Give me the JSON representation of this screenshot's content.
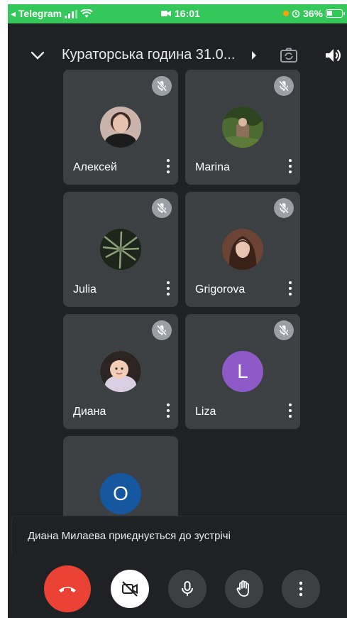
{
  "status_bar": {
    "back_app": "◂ Telegram",
    "time": "16:01",
    "battery": "36%",
    "battery_level": 0.36
  },
  "header": {
    "title": "Кураторська година 31.0..."
  },
  "participants": [
    {
      "name": "Алексей",
      "muted": true,
      "avatar_kind": "photo"
    },
    {
      "name": "Marina",
      "muted": true,
      "avatar_kind": "photo"
    },
    {
      "name": "Julia",
      "muted": true,
      "avatar_kind": "photo"
    },
    {
      "name": "Grigorova",
      "muted": true,
      "avatar_kind": "photo"
    },
    {
      "name": "Диана",
      "muted": true,
      "avatar_kind": "photo"
    },
    {
      "name": "Liza",
      "muted": true,
      "avatar_kind": "initial",
      "initial": "L",
      "color": "#8e5ac8"
    },
    {
      "name": "",
      "muted": false,
      "avatar_kind": "initial",
      "initial": "O",
      "color": "#1557a0"
    }
  ],
  "toast": {
    "message": "Диана Милаева приєднується до зустрічі"
  },
  "controls": {
    "end_call_color": "#ea4335",
    "camera_off_bg": "#ffffff",
    "button_bg": "#3c4043"
  },
  "icons": [
    "chevron-down-icon",
    "play-arrow-icon",
    "camera-switch-icon",
    "speaker-icon",
    "mic-off-icon",
    "more-vert-icon",
    "hangup-icon",
    "video-off-icon",
    "mic-icon",
    "hand-raise-icon"
  ]
}
